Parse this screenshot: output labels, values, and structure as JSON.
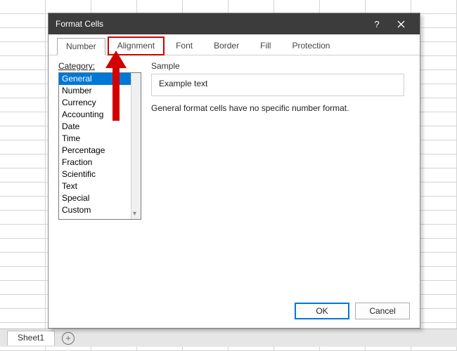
{
  "sheet": {
    "tab": "Sheet1"
  },
  "dialog": {
    "title": "Format Cells",
    "tabs": {
      "number": "Number",
      "alignment": "Alignment",
      "font": "Font",
      "border": "Border",
      "fill": "Fill",
      "protection": "Protection"
    },
    "category_label": "Category:",
    "categories": [
      "General",
      "Number",
      "Currency",
      "Accounting",
      "Date",
      "Time",
      "Percentage",
      "Fraction",
      "Scientific",
      "Text",
      "Special",
      "Custom"
    ],
    "sample": {
      "label": "Sample",
      "value": "Example text"
    },
    "description": "General format cells have no specific number format.",
    "buttons": {
      "ok": "OK",
      "cancel": "Cancel"
    }
  }
}
